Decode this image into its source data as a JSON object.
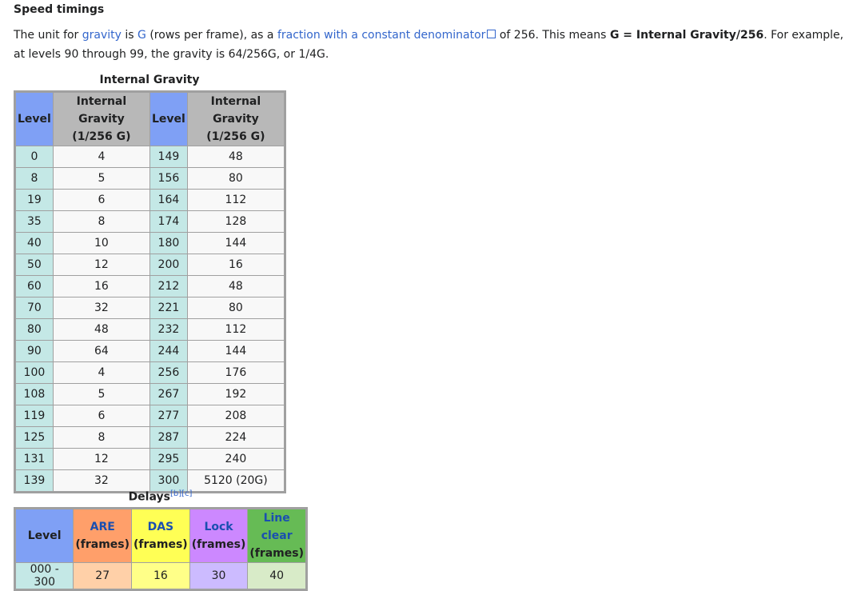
{
  "heading": "Speed timings",
  "intro": {
    "t1": "The unit for ",
    "link1": "gravity",
    "t2": " is ",
    "link2": "G",
    "t3": " (rows per frame), as a ",
    "link3": "fraction with a constant denominator",
    "t4": " of 256. This means ",
    "bold": "G = Internal Gravity/256",
    "t5": ". For example, at levels 90 through 99, the gravity is 64/256G, or 1/4G."
  },
  "gravity_table": {
    "caption": "Internal Gravity",
    "headers": {
      "level": "Level",
      "gravity_l1": "Internal Gravity",
      "gravity_l2": "(1/256 G)"
    },
    "rows": [
      [
        "0",
        "4",
        "149",
        "48"
      ],
      [
        "8",
        "5",
        "156",
        "80"
      ],
      [
        "19",
        "6",
        "164",
        "112"
      ],
      [
        "35",
        "8",
        "174",
        "128"
      ],
      [
        "40",
        "10",
        "180",
        "144"
      ],
      [
        "50",
        "12",
        "200",
        "16"
      ],
      [
        "60",
        "16",
        "212",
        "48"
      ],
      [
        "70",
        "32",
        "221",
        "80"
      ],
      [
        "80",
        "48",
        "232",
        "112"
      ],
      [
        "90",
        "64",
        "244",
        "144"
      ],
      [
        "100",
        "4",
        "256",
        "176"
      ],
      [
        "108",
        "5",
        "267",
        "192"
      ],
      [
        "119",
        "6",
        "277",
        "208"
      ],
      [
        "125",
        "8",
        "287",
        "224"
      ],
      [
        "131",
        "12",
        "295",
        "240"
      ],
      [
        "139",
        "32",
        "300",
        "5120 (20G)"
      ]
    ]
  },
  "delays_table": {
    "caption": "Delays",
    "ref_b": "[b]",
    "ref_c": "[c]",
    "headers": {
      "level": "Level",
      "are": "ARE",
      "das": "DAS",
      "lock": "Lock",
      "line_clear": "Line clear",
      "frames": "(frames)"
    },
    "row": {
      "level": "000 - 300",
      "are": "27",
      "das": "16",
      "lock": "30",
      "line_clear": "40"
    }
  },
  "colors": {
    "link": "#3366cc",
    "level_header": "#7fa0f5",
    "are": "#ff9f6a",
    "das": "#ffff55",
    "lock": "#cc88ff",
    "line_clear": "#66bb55"
  }
}
